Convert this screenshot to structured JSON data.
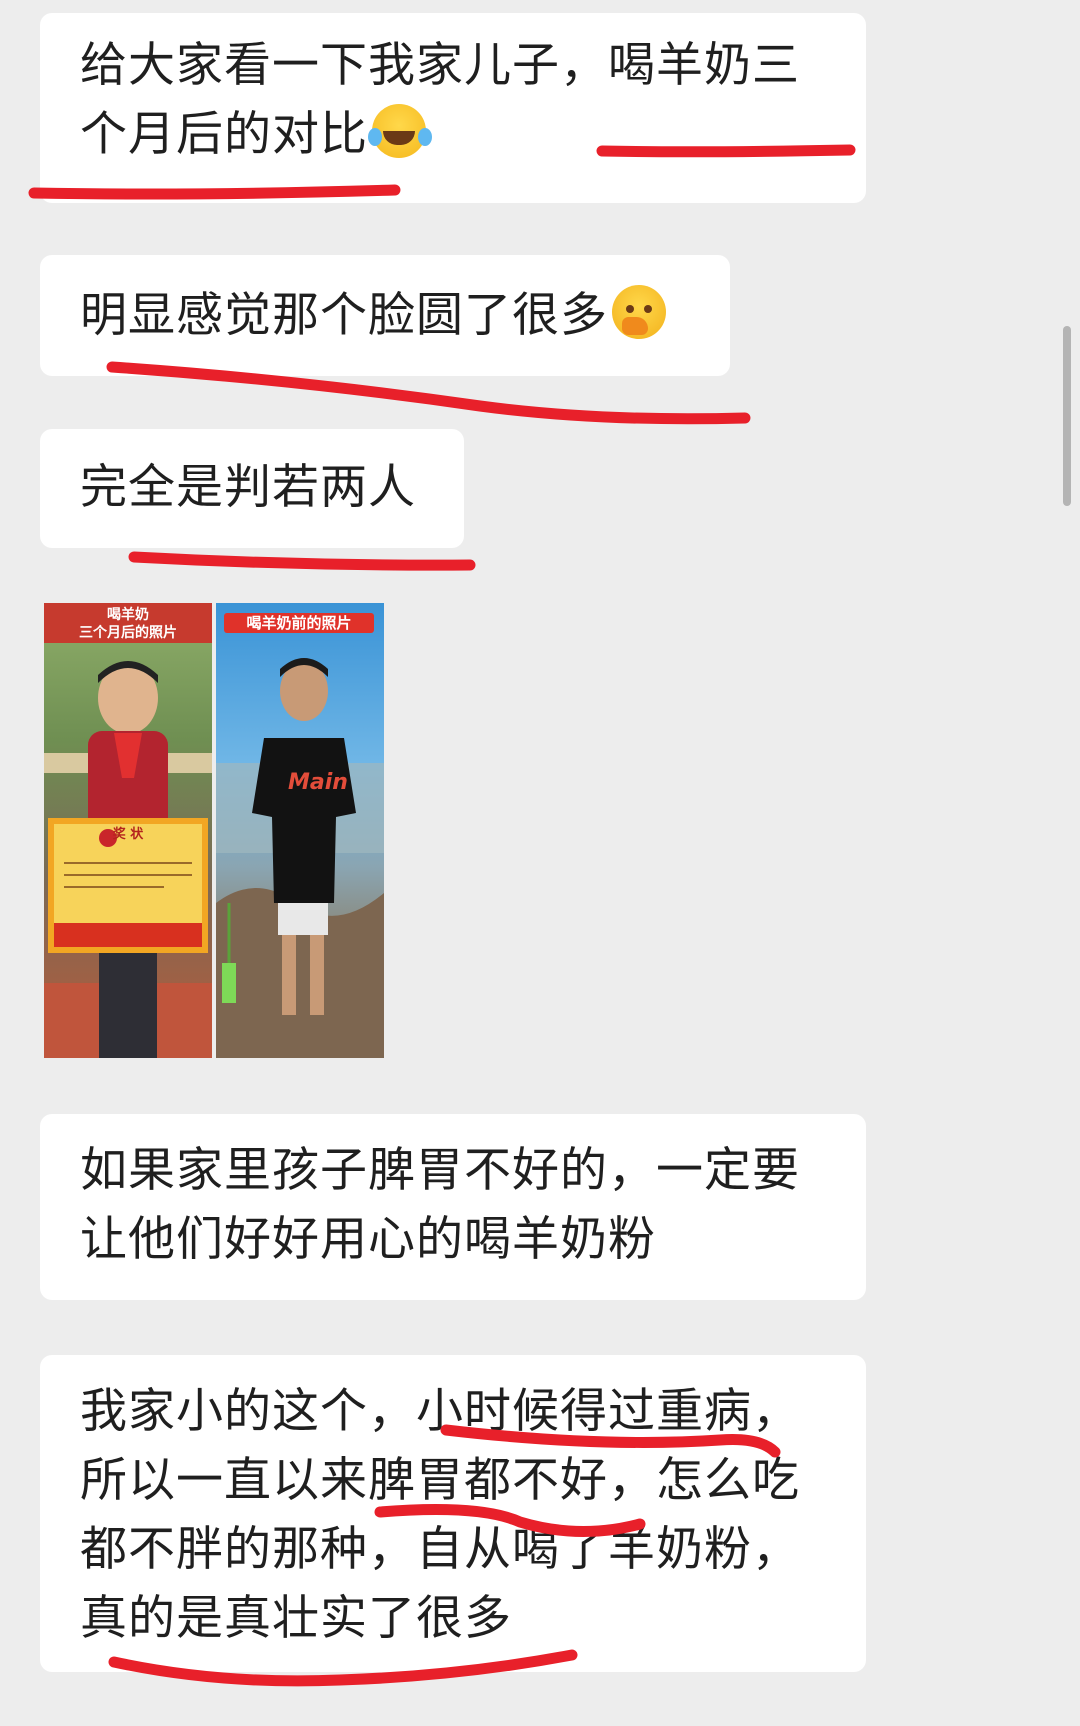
{
  "chat": {
    "messages": [
      {
        "lines": [
          "给大家看一下我家儿子，喝羊奶三",
          "个月后的对比"
        ],
        "emoji": "laughing-tears"
      },
      {
        "lines": [
          "明显感觉那个脸圆了很多"
        ],
        "emoji": "thinking-face"
      },
      {
        "lines": [
          "完全是判若两人"
        ]
      },
      {
        "lines": [
          "如果家里孩子脾胃不好的，一定要",
          "让他们好好用心的喝羊奶粉"
        ]
      },
      {
        "lines": [
          "我家小的这个，小时候得过重病，",
          "所以一直以来脾胃都不好，怎么吃",
          "都不胖的那种，自从喝了羊奶粉，",
          "真的是真壮实了很多"
        ]
      }
    ],
    "image_message": {
      "left_photo": {
        "caption_line1": "喝羊奶",
        "caption_line2": "三个月后的照片",
        "certificate_title": "奖  状"
      },
      "right_photo": {
        "caption": "喝羊奶前的照片",
        "shirt_text": "Main"
      }
    }
  },
  "colors": {
    "background": "#ededed",
    "bubble": "#ffffff",
    "text": "#1f1f1f",
    "underline": "#e8202a"
  }
}
